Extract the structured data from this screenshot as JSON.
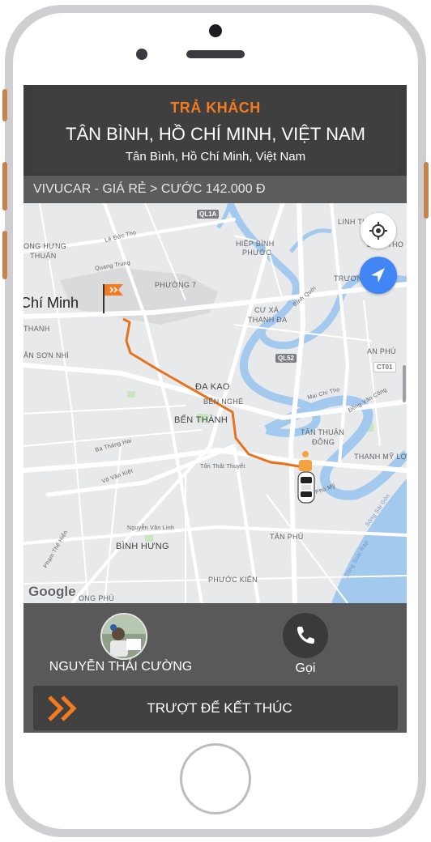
{
  "colors": {
    "accent": "#f47b20",
    "header_bg": "#3f3f3f",
    "fare_bar_bg": "#5c5c5c",
    "bottom_bg": "#595959",
    "route_line": "#e8711c",
    "water": "#a4c9ef",
    "nav_blue": "#4285f4"
  },
  "header": {
    "label": "TRẢ KHÁCH",
    "destination": "TÂN BÌNH, HỒ CHÍ MINH, VIỆT NAM",
    "subtitle": "Tân Bình, Hồ Chí Minh, Việt Nam"
  },
  "fare": {
    "text": "VIVUCAR - GIÁ RẺ > CƯỚC 142.000 Đ"
  },
  "map": {
    "labels": {
      "ql1a": "QL1A",
      "linh_tho": "LINH THO",
      "binh_tho": "BÌNH THO",
      "hiep_binh_phuoc_1": "HIỆP BÌNH",
      "hiep_binh_phuoc_2": "PHƯỚC",
      "truong": "TRƯƠNG",
      "le_duc_tho": "Lê Đức Thọ",
      "quang_trung": "Quang Trung",
      "phuong_7": "PHƯỜNG 7",
      "city": "Chí Minh",
      "ong_hung_1": "ONG HƯNG",
      "ong_hung_2": "THUẬN",
      "cu_xa_1": "CƯ XÁ",
      "cu_xa_2": "THANH ĐA",
      "binh_quoi": "Bình Quới",
      "thanh": "THANH",
      "an_son_nhi": "ÂN SƠN NHÌ",
      "ql52": "QL52",
      "an_phu": "AN PHÚ",
      "ct01": "CT01",
      "mai_chi_tho": "Mai Chí Thọ",
      "dong_van_cong": "Đồng Văn Cống",
      "da_kao": "ĐA KAO",
      "ben_nghe": "BẾN NGHÉ",
      "ben_thanh": "BẾN THÀNH",
      "ba_thang_hai": "Ba Tháng Hai",
      "vo_van_kiet": "Võ Văn Kiệt",
      "ton_that_thuyet": "Tôn Thất Thuyết",
      "tan_thuan_1": "TÂN THUẬN",
      "tan_thuan_2": "ĐÔNG",
      "phu_my": "Phú Mỹ",
      "thanh_my_loi": "THANH MỸ LỢI",
      "nguyen_van_linh": "Nguyễn Văn Linh",
      "pham_the_hien": "Phạm Thế Hiển",
      "binh_hung": "BÌNH HƯNG",
      "tan_phu": "TÂN PHÚ",
      "phuoc_kien": "PHƯỚC KIỂN",
      "song_sai_gon": "Sông Sài Gòn",
      "song_soai_rap": "Sông Soài Rạp",
      "ong_phu": "ONG PHÚ"
    },
    "google": "Google",
    "icons": {
      "flag": "destination-flag-icon",
      "car": "car-icon",
      "location": "my-location-icon",
      "navigation": "navigation-arrow-icon"
    }
  },
  "driver": {
    "name": "NGUYỄN THÁI CƯỜNG"
  },
  "call": {
    "label": "Gọi"
  },
  "slider": {
    "label": "TRƯỢT ĐỂ KẾT THÚC"
  }
}
